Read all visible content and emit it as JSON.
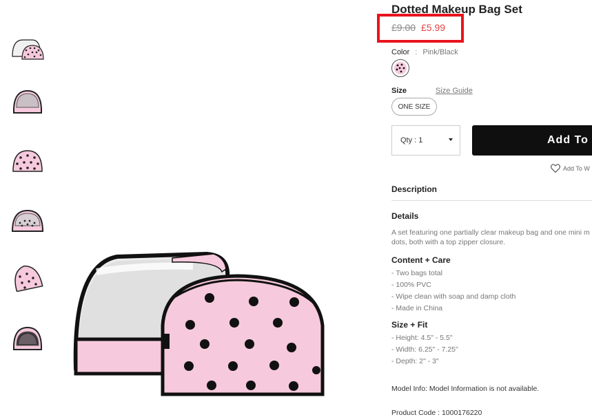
{
  "product": {
    "title": "Dotted Makeup Bag Set",
    "price_original": "£9.00",
    "price_sale": "£5.99",
    "color_label": "Color",
    "color_separator": ":",
    "color_value": "Pink/Black",
    "size_label": "Size",
    "size_guide_label": "Size Guide",
    "size_option": "ONE SIZE",
    "qty_label": "Qty : 1",
    "add_button_label": "Add To",
    "wishlist_label": "Add To W"
  },
  "description": {
    "heading": "Description",
    "details_heading": "Details",
    "details_text": "A set featuring one partially clear makeup bag and one mini m... dots, both with a top zipper closure.",
    "details_line1": "A set featuring one partially clear makeup bag and one mini m",
    "details_line2": "dots, both with a top zipper closure.",
    "care_heading": "Content + Care",
    "care_items": [
      "- Two bags total",
      "- 100% PVC",
      "- Wipe clean with soap and damp cloth",
      "- Made in China"
    ],
    "fit_heading": "Size + Fit",
    "fit_items": [
      "- Height: 4.5\" - 5.5\"",
      "- Width: 6.25\" - 7.25\"",
      "- Depth: 2\" - 3\""
    ],
    "model_info": "Model Info: Model Information is not available.",
    "product_code": "Product Code : 1000176220"
  },
  "colors": {
    "sale_price": "#e34444",
    "highlight_box": "#e8141c",
    "bag_pink": "#f6c9dc",
    "dots": "#111111",
    "button": "#0f0f0f"
  },
  "icons": {
    "wishlist": "heart-outline-icon",
    "qty_dropdown": "caret-down-icon"
  }
}
